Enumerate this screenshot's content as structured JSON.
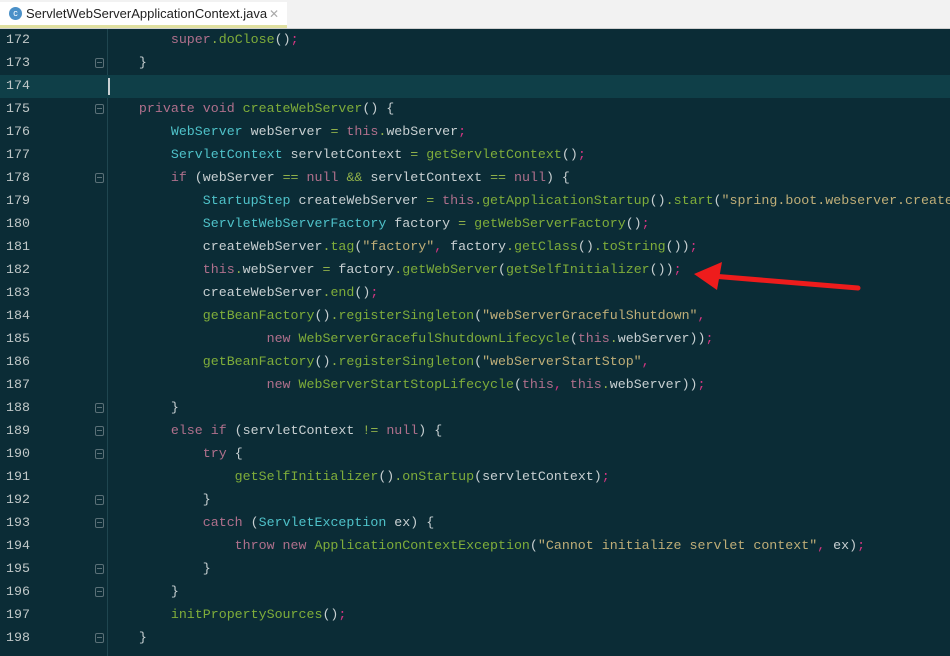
{
  "tab": {
    "title": "ServletWebServerApplicationContext.java",
    "icon": "class-icon",
    "close": "✕"
  },
  "colors": {
    "background": "#0b2c36",
    "annotation_arrow": "#ee1c1c"
  },
  "current_line": 174,
  "lines": [
    {
      "n": "172",
      "fold": false,
      "tokens": [
        [
          "p",
          "        "
        ],
        [
          "k",
          "super"
        ],
        [
          "o",
          "."
        ],
        [
          "m",
          "doClose"
        ],
        [
          "p",
          "()"
        ],
        [
          "x",
          ";"
        ]
      ]
    },
    {
      "n": "173",
      "fold": true,
      "tokens": [
        [
          "p",
          "    }"
        ]
      ]
    },
    {
      "n": "174",
      "fold": false,
      "tokens": []
    },
    {
      "n": "175",
      "fold": true,
      "tokens": [
        [
          "p",
          "    "
        ],
        [
          "k",
          "private void "
        ],
        [
          "m",
          "createWebServer"
        ],
        [
          "p",
          "() {"
        ]
      ]
    },
    {
      "n": "176",
      "fold": false,
      "tokens": [
        [
          "p",
          "        "
        ],
        [
          "t",
          "WebServer"
        ],
        [
          "p",
          " webServer "
        ],
        [
          "o",
          "="
        ],
        [
          "p",
          " "
        ],
        [
          "k",
          "this"
        ],
        [
          "o",
          "."
        ],
        [
          "p",
          "webServer"
        ],
        [
          "x",
          ";"
        ]
      ]
    },
    {
      "n": "177",
      "fold": false,
      "tokens": [
        [
          "p",
          "        "
        ],
        [
          "t",
          "ServletContext"
        ],
        [
          "p",
          " servletContext "
        ],
        [
          "o",
          "="
        ],
        [
          "p",
          " "
        ],
        [
          "m",
          "getServletContext"
        ],
        [
          "p",
          "()"
        ],
        [
          "x",
          ";"
        ]
      ]
    },
    {
      "n": "178",
      "fold": true,
      "tokens": [
        [
          "p",
          "        "
        ],
        [
          "k",
          "if"
        ],
        [
          "p",
          " (webServer "
        ],
        [
          "o",
          "=="
        ],
        [
          "p",
          " "
        ],
        [
          "k",
          "null"
        ],
        [
          "p",
          " "
        ],
        [
          "o",
          "&&"
        ],
        [
          "p",
          " servletContext "
        ],
        [
          "o",
          "=="
        ],
        [
          "p",
          " "
        ],
        [
          "k",
          "null"
        ],
        [
          "p",
          ") {"
        ]
      ]
    },
    {
      "n": "179",
      "fold": false,
      "tokens": [
        [
          "p",
          "            "
        ],
        [
          "t",
          "StartupStep"
        ],
        [
          "p",
          " createWebServer "
        ],
        [
          "o",
          "="
        ],
        [
          "p",
          " "
        ],
        [
          "k",
          "this"
        ],
        [
          "o",
          "."
        ],
        [
          "m",
          "getApplicationStartup"
        ],
        [
          "p",
          "()"
        ],
        [
          "o",
          "."
        ],
        [
          "m",
          "start"
        ],
        [
          "p",
          "("
        ],
        [
          "s",
          "\"spring.boot.webserver.create\""
        ],
        [
          "p",
          ")"
        ],
        [
          "x",
          ";"
        ]
      ]
    },
    {
      "n": "180",
      "fold": false,
      "tokens": [
        [
          "p",
          "            "
        ],
        [
          "t",
          "ServletWebServerFactory"
        ],
        [
          "p",
          " factory "
        ],
        [
          "o",
          "="
        ],
        [
          "p",
          " "
        ],
        [
          "m",
          "getWebServerFactory"
        ],
        [
          "p",
          "()"
        ],
        [
          "x",
          ";"
        ]
      ]
    },
    {
      "n": "181",
      "fold": false,
      "tokens": [
        [
          "p",
          "            createWebServer"
        ],
        [
          "o",
          "."
        ],
        [
          "m",
          "tag"
        ],
        [
          "p",
          "("
        ],
        [
          "s",
          "\"factory\""
        ],
        [
          "x",
          ","
        ],
        [
          "p",
          " factory"
        ],
        [
          "o",
          "."
        ],
        [
          "m",
          "getClass"
        ],
        [
          "p",
          "()"
        ],
        [
          "o",
          "."
        ],
        [
          "m",
          "toString"
        ],
        [
          "p",
          "())"
        ],
        [
          "x",
          ";"
        ]
      ]
    },
    {
      "n": "182",
      "fold": false,
      "tokens": [
        [
          "p",
          "            "
        ],
        [
          "k",
          "this"
        ],
        [
          "o",
          "."
        ],
        [
          "p",
          "webServer "
        ],
        [
          "o",
          "="
        ],
        [
          "p",
          " factory"
        ],
        [
          "o",
          "."
        ],
        [
          "m",
          "getWebServer"
        ],
        [
          "p",
          "("
        ],
        [
          "m",
          "getSelfInitializer"
        ],
        [
          "p",
          "())"
        ],
        [
          "x",
          ";"
        ]
      ]
    },
    {
      "n": "183",
      "fold": false,
      "tokens": [
        [
          "p",
          "            createWebServer"
        ],
        [
          "o",
          "."
        ],
        [
          "m",
          "end"
        ],
        [
          "p",
          "()"
        ],
        [
          "x",
          ";"
        ]
      ]
    },
    {
      "n": "184",
      "fold": false,
      "tokens": [
        [
          "p",
          "            "
        ],
        [
          "m",
          "getBeanFactory"
        ],
        [
          "p",
          "()"
        ],
        [
          "o",
          "."
        ],
        [
          "m",
          "registerSingleton"
        ],
        [
          "p",
          "("
        ],
        [
          "s",
          "\"webServerGracefulShutdown\""
        ],
        [
          "x",
          ","
        ]
      ]
    },
    {
      "n": "185",
      "fold": false,
      "tokens": [
        [
          "p",
          "                    "
        ],
        [
          "k",
          "new "
        ],
        [
          "m",
          "WebServerGracefulShutdownLifecycle"
        ],
        [
          "p",
          "("
        ],
        [
          "k",
          "this"
        ],
        [
          "o",
          "."
        ],
        [
          "p",
          "webServer))"
        ],
        [
          "x",
          ";"
        ]
      ]
    },
    {
      "n": "186",
      "fold": false,
      "tokens": [
        [
          "p",
          "            "
        ],
        [
          "m",
          "getBeanFactory"
        ],
        [
          "p",
          "()"
        ],
        [
          "o",
          "."
        ],
        [
          "m",
          "registerSingleton"
        ],
        [
          "p",
          "("
        ],
        [
          "s",
          "\"webServerStartStop\""
        ],
        [
          "x",
          ","
        ]
      ]
    },
    {
      "n": "187",
      "fold": false,
      "tokens": [
        [
          "p",
          "                    "
        ],
        [
          "k",
          "new "
        ],
        [
          "m",
          "WebServerStartStopLifecycle"
        ],
        [
          "p",
          "("
        ],
        [
          "k",
          "this"
        ],
        [
          "x",
          ","
        ],
        [
          "p",
          " "
        ],
        [
          "k",
          "this"
        ],
        [
          "o",
          "."
        ],
        [
          "p",
          "webServer))"
        ],
        [
          "x",
          ";"
        ]
      ]
    },
    {
      "n": "188",
      "fold": true,
      "tokens": [
        [
          "p",
          "        }"
        ]
      ]
    },
    {
      "n": "189",
      "fold": true,
      "tokens": [
        [
          "p",
          "        "
        ],
        [
          "k",
          "else if"
        ],
        [
          "p",
          " (servletContext "
        ],
        [
          "o",
          "!="
        ],
        [
          "p",
          " "
        ],
        [
          "k",
          "null"
        ],
        [
          "p",
          ") {"
        ]
      ]
    },
    {
      "n": "190",
      "fold": true,
      "tokens": [
        [
          "p",
          "            "
        ],
        [
          "k",
          "try"
        ],
        [
          "p",
          " {"
        ]
      ]
    },
    {
      "n": "191",
      "fold": false,
      "tokens": [
        [
          "p",
          "                "
        ],
        [
          "m",
          "getSelfInitializer"
        ],
        [
          "p",
          "()"
        ],
        [
          "o",
          "."
        ],
        [
          "m",
          "onStartup"
        ],
        [
          "p",
          "(servletContext)"
        ],
        [
          "x",
          ";"
        ]
      ]
    },
    {
      "n": "192",
      "fold": true,
      "tokens": [
        [
          "p",
          "            }"
        ]
      ]
    },
    {
      "n": "193",
      "fold": true,
      "tokens": [
        [
          "p",
          "            "
        ],
        [
          "k",
          "catch"
        ],
        [
          "p",
          " ("
        ],
        [
          "t",
          "ServletException"
        ],
        [
          "p",
          " ex) {"
        ]
      ]
    },
    {
      "n": "194",
      "fold": false,
      "tokens": [
        [
          "p",
          "                "
        ],
        [
          "k",
          "throw new "
        ],
        [
          "m",
          "ApplicationContextException"
        ],
        [
          "p",
          "("
        ],
        [
          "s",
          "\"Cannot initialize servlet context\""
        ],
        [
          "x",
          ","
        ],
        [
          "p",
          " ex)"
        ],
        [
          "x",
          ";"
        ]
      ]
    },
    {
      "n": "195",
      "fold": true,
      "tokens": [
        [
          "p",
          "            }"
        ]
      ]
    },
    {
      "n": "196",
      "fold": true,
      "tokens": [
        [
          "p",
          "        }"
        ]
      ]
    },
    {
      "n": "197",
      "fold": false,
      "tokens": [
        [
          "p",
          "        "
        ],
        [
          "m",
          "initPropertySources"
        ],
        [
          "p",
          "()"
        ],
        [
          "x",
          ";"
        ]
      ]
    },
    {
      "n": "198",
      "fold": true,
      "tokens": [
        [
          "p",
          "    }"
        ]
      ]
    }
  ]
}
